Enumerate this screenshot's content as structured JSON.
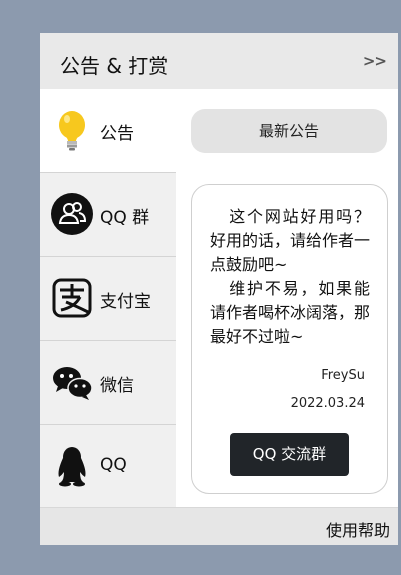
{
  "header": {
    "title": "公告 & 打赏",
    "toggle_label": ">>"
  },
  "sidebar": {
    "items": [
      {
        "label": "公告",
        "icon": "lightbulb-icon",
        "active": true
      },
      {
        "label": "QQ 群",
        "icon": "qq-group-icon",
        "active": false
      },
      {
        "label": "支付宝",
        "icon": "alipay-icon",
        "active": false
      },
      {
        "label": "微信",
        "icon": "wechat-icon",
        "active": false
      },
      {
        "label": "QQ",
        "icon": "qq-penguin-icon",
        "active": false
      }
    ]
  },
  "main": {
    "latest_button": "最新公告",
    "message_lines": [
      "这个网站好用吗？好用的话，请给作者一点鼓励吧~",
      "维护不易，如果能请作者喝杯冰阔落，那最好不过啦~"
    ],
    "author": "FreySu",
    "date": "2022.03.24",
    "qq_group_button": "QQ 交流群"
  },
  "footer": {
    "help_label": "使用帮助"
  },
  "colors": {
    "background": "#8c9aae",
    "dark_button": "#212529",
    "bulb": "#f7c81e"
  }
}
